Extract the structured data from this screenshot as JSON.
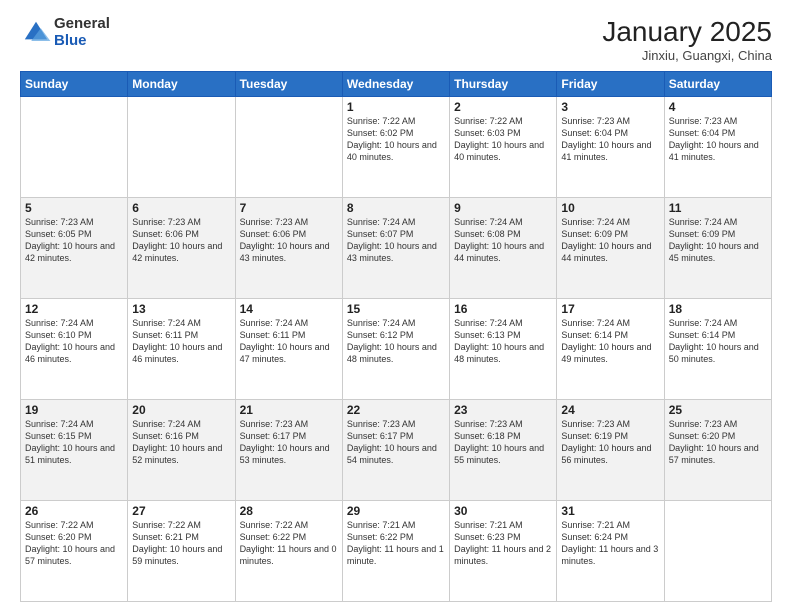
{
  "logo": {
    "general": "General",
    "blue": "Blue"
  },
  "header": {
    "month": "January 2025",
    "location": "Jinxiu, Guangxi, China"
  },
  "weekdays": [
    "Sunday",
    "Monday",
    "Tuesday",
    "Wednesday",
    "Thursday",
    "Friday",
    "Saturday"
  ],
  "weeks": [
    [
      {
        "day": "",
        "sunrise": "",
        "sunset": "",
        "daylight": ""
      },
      {
        "day": "",
        "sunrise": "",
        "sunset": "",
        "daylight": ""
      },
      {
        "day": "",
        "sunrise": "",
        "sunset": "",
        "daylight": ""
      },
      {
        "day": "1",
        "sunrise": "Sunrise: 7:22 AM",
        "sunset": "Sunset: 6:02 PM",
        "daylight": "Daylight: 10 hours and 40 minutes."
      },
      {
        "day": "2",
        "sunrise": "Sunrise: 7:22 AM",
        "sunset": "Sunset: 6:03 PM",
        "daylight": "Daylight: 10 hours and 40 minutes."
      },
      {
        "day": "3",
        "sunrise": "Sunrise: 7:23 AM",
        "sunset": "Sunset: 6:04 PM",
        "daylight": "Daylight: 10 hours and 41 minutes."
      },
      {
        "day": "4",
        "sunrise": "Sunrise: 7:23 AM",
        "sunset": "Sunset: 6:04 PM",
        "daylight": "Daylight: 10 hours and 41 minutes."
      }
    ],
    [
      {
        "day": "5",
        "sunrise": "Sunrise: 7:23 AM",
        "sunset": "Sunset: 6:05 PM",
        "daylight": "Daylight: 10 hours and 42 minutes."
      },
      {
        "day": "6",
        "sunrise": "Sunrise: 7:23 AM",
        "sunset": "Sunset: 6:06 PM",
        "daylight": "Daylight: 10 hours and 42 minutes."
      },
      {
        "day": "7",
        "sunrise": "Sunrise: 7:23 AM",
        "sunset": "Sunset: 6:06 PM",
        "daylight": "Daylight: 10 hours and 43 minutes."
      },
      {
        "day": "8",
        "sunrise": "Sunrise: 7:24 AM",
        "sunset": "Sunset: 6:07 PM",
        "daylight": "Daylight: 10 hours and 43 minutes."
      },
      {
        "day": "9",
        "sunrise": "Sunrise: 7:24 AM",
        "sunset": "Sunset: 6:08 PM",
        "daylight": "Daylight: 10 hours and 44 minutes."
      },
      {
        "day": "10",
        "sunrise": "Sunrise: 7:24 AM",
        "sunset": "Sunset: 6:09 PM",
        "daylight": "Daylight: 10 hours and 44 minutes."
      },
      {
        "day": "11",
        "sunrise": "Sunrise: 7:24 AM",
        "sunset": "Sunset: 6:09 PM",
        "daylight": "Daylight: 10 hours and 45 minutes."
      }
    ],
    [
      {
        "day": "12",
        "sunrise": "Sunrise: 7:24 AM",
        "sunset": "Sunset: 6:10 PM",
        "daylight": "Daylight: 10 hours and 46 minutes."
      },
      {
        "day": "13",
        "sunrise": "Sunrise: 7:24 AM",
        "sunset": "Sunset: 6:11 PM",
        "daylight": "Daylight: 10 hours and 46 minutes."
      },
      {
        "day": "14",
        "sunrise": "Sunrise: 7:24 AM",
        "sunset": "Sunset: 6:11 PM",
        "daylight": "Daylight: 10 hours and 47 minutes."
      },
      {
        "day": "15",
        "sunrise": "Sunrise: 7:24 AM",
        "sunset": "Sunset: 6:12 PM",
        "daylight": "Daylight: 10 hours and 48 minutes."
      },
      {
        "day": "16",
        "sunrise": "Sunrise: 7:24 AM",
        "sunset": "Sunset: 6:13 PM",
        "daylight": "Daylight: 10 hours and 48 minutes."
      },
      {
        "day": "17",
        "sunrise": "Sunrise: 7:24 AM",
        "sunset": "Sunset: 6:14 PM",
        "daylight": "Daylight: 10 hours and 49 minutes."
      },
      {
        "day": "18",
        "sunrise": "Sunrise: 7:24 AM",
        "sunset": "Sunset: 6:14 PM",
        "daylight": "Daylight: 10 hours and 50 minutes."
      }
    ],
    [
      {
        "day": "19",
        "sunrise": "Sunrise: 7:24 AM",
        "sunset": "Sunset: 6:15 PM",
        "daylight": "Daylight: 10 hours and 51 minutes."
      },
      {
        "day": "20",
        "sunrise": "Sunrise: 7:24 AM",
        "sunset": "Sunset: 6:16 PM",
        "daylight": "Daylight: 10 hours and 52 minutes."
      },
      {
        "day": "21",
        "sunrise": "Sunrise: 7:23 AM",
        "sunset": "Sunset: 6:17 PM",
        "daylight": "Daylight: 10 hours and 53 minutes."
      },
      {
        "day": "22",
        "sunrise": "Sunrise: 7:23 AM",
        "sunset": "Sunset: 6:17 PM",
        "daylight": "Daylight: 10 hours and 54 minutes."
      },
      {
        "day": "23",
        "sunrise": "Sunrise: 7:23 AM",
        "sunset": "Sunset: 6:18 PM",
        "daylight": "Daylight: 10 hours and 55 minutes."
      },
      {
        "day": "24",
        "sunrise": "Sunrise: 7:23 AM",
        "sunset": "Sunset: 6:19 PM",
        "daylight": "Daylight: 10 hours and 56 minutes."
      },
      {
        "day": "25",
        "sunrise": "Sunrise: 7:23 AM",
        "sunset": "Sunset: 6:20 PM",
        "daylight": "Daylight: 10 hours and 57 minutes."
      }
    ],
    [
      {
        "day": "26",
        "sunrise": "Sunrise: 7:22 AM",
        "sunset": "Sunset: 6:20 PM",
        "daylight": "Daylight: 10 hours and 57 minutes."
      },
      {
        "day": "27",
        "sunrise": "Sunrise: 7:22 AM",
        "sunset": "Sunset: 6:21 PM",
        "daylight": "Daylight: 10 hours and 59 minutes."
      },
      {
        "day": "28",
        "sunrise": "Sunrise: 7:22 AM",
        "sunset": "Sunset: 6:22 PM",
        "daylight": "Daylight: 11 hours and 0 minutes."
      },
      {
        "day": "29",
        "sunrise": "Sunrise: 7:21 AM",
        "sunset": "Sunset: 6:22 PM",
        "daylight": "Daylight: 11 hours and 1 minute."
      },
      {
        "day": "30",
        "sunrise": "Sunrise: 7:21 AM",
        "sunset": "Sunset: 6:23 PM",
        "daylight": "Daylight: 11 hours and 2 minutes."
      },
      {
        "day": "31",
        "sunrise": "Sunrise: 7:21 AM",
        "sunset": "Sunset: 6:24 PM",
        "daylight": "Daylight: 11 hours and 3 minutes."
      },
      {
        "day": "",
        "sunrise": "",
        "sunset": "",
        "daylight": ""
      }
    ]
  ]
}
